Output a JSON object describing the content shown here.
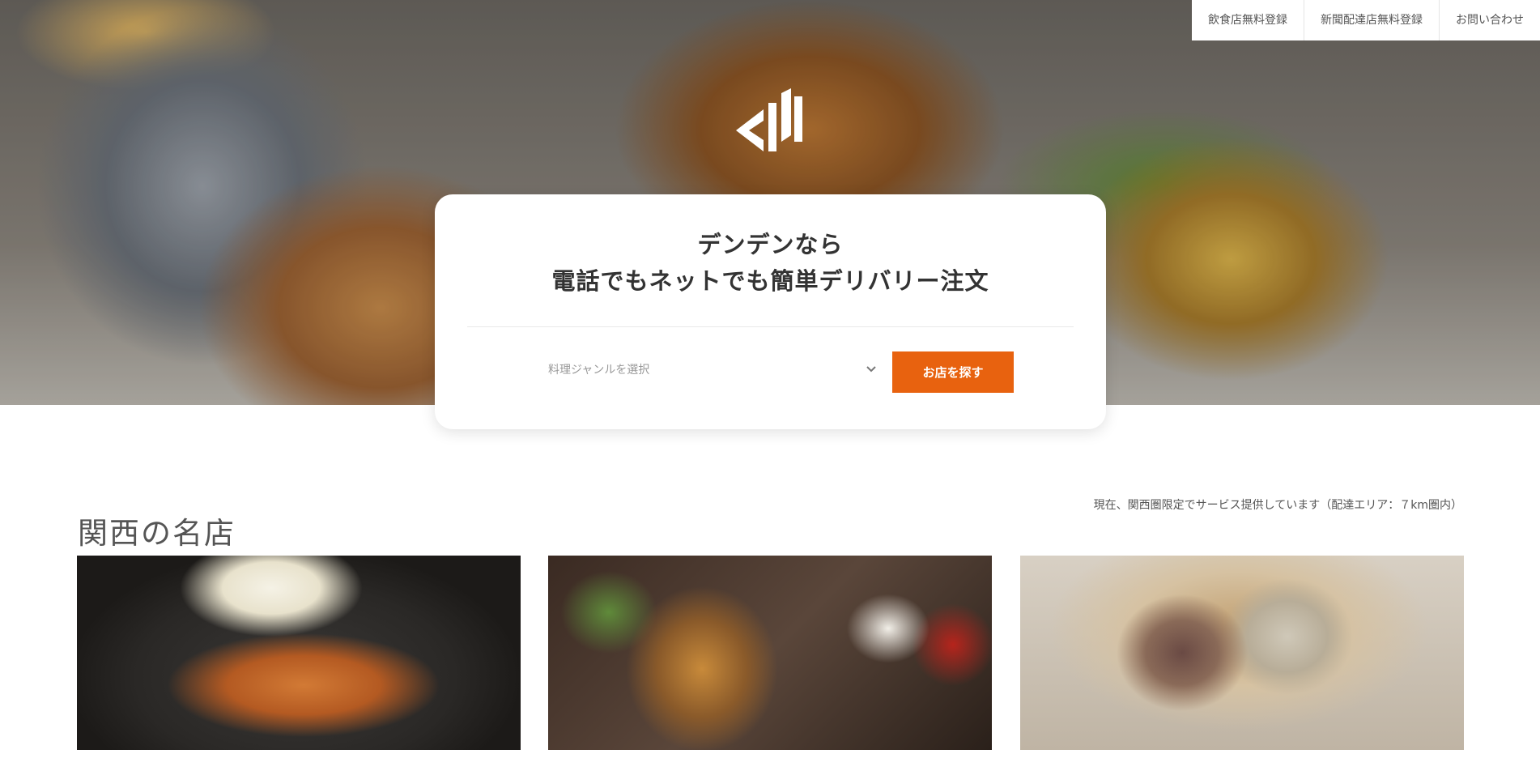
{
  "nav": {
    "items": [
      "飲食店無料登録",
      "新聞配達店無料登録",
      "お問い合わせ"
    ]
  },
  "hero": {
    "logo_icon": "dd-logo-icon",
    "title_line1": "デンデンなら",
    "title_line2": "電話でもネットでも簡単デリバリー注文",
    "genre_placeholder": "料理ジャンルを選択",
    "search_button": "お店を探す"
  },
  "section": {
    "title": "関西の名店",
    "note": "現在、関西圏限定でサービス提供しています（配達エリア：７km圏内）"
  },
  "colors": {
    "accent": "#e8620f",
    "text": "#333333"
  }
}
